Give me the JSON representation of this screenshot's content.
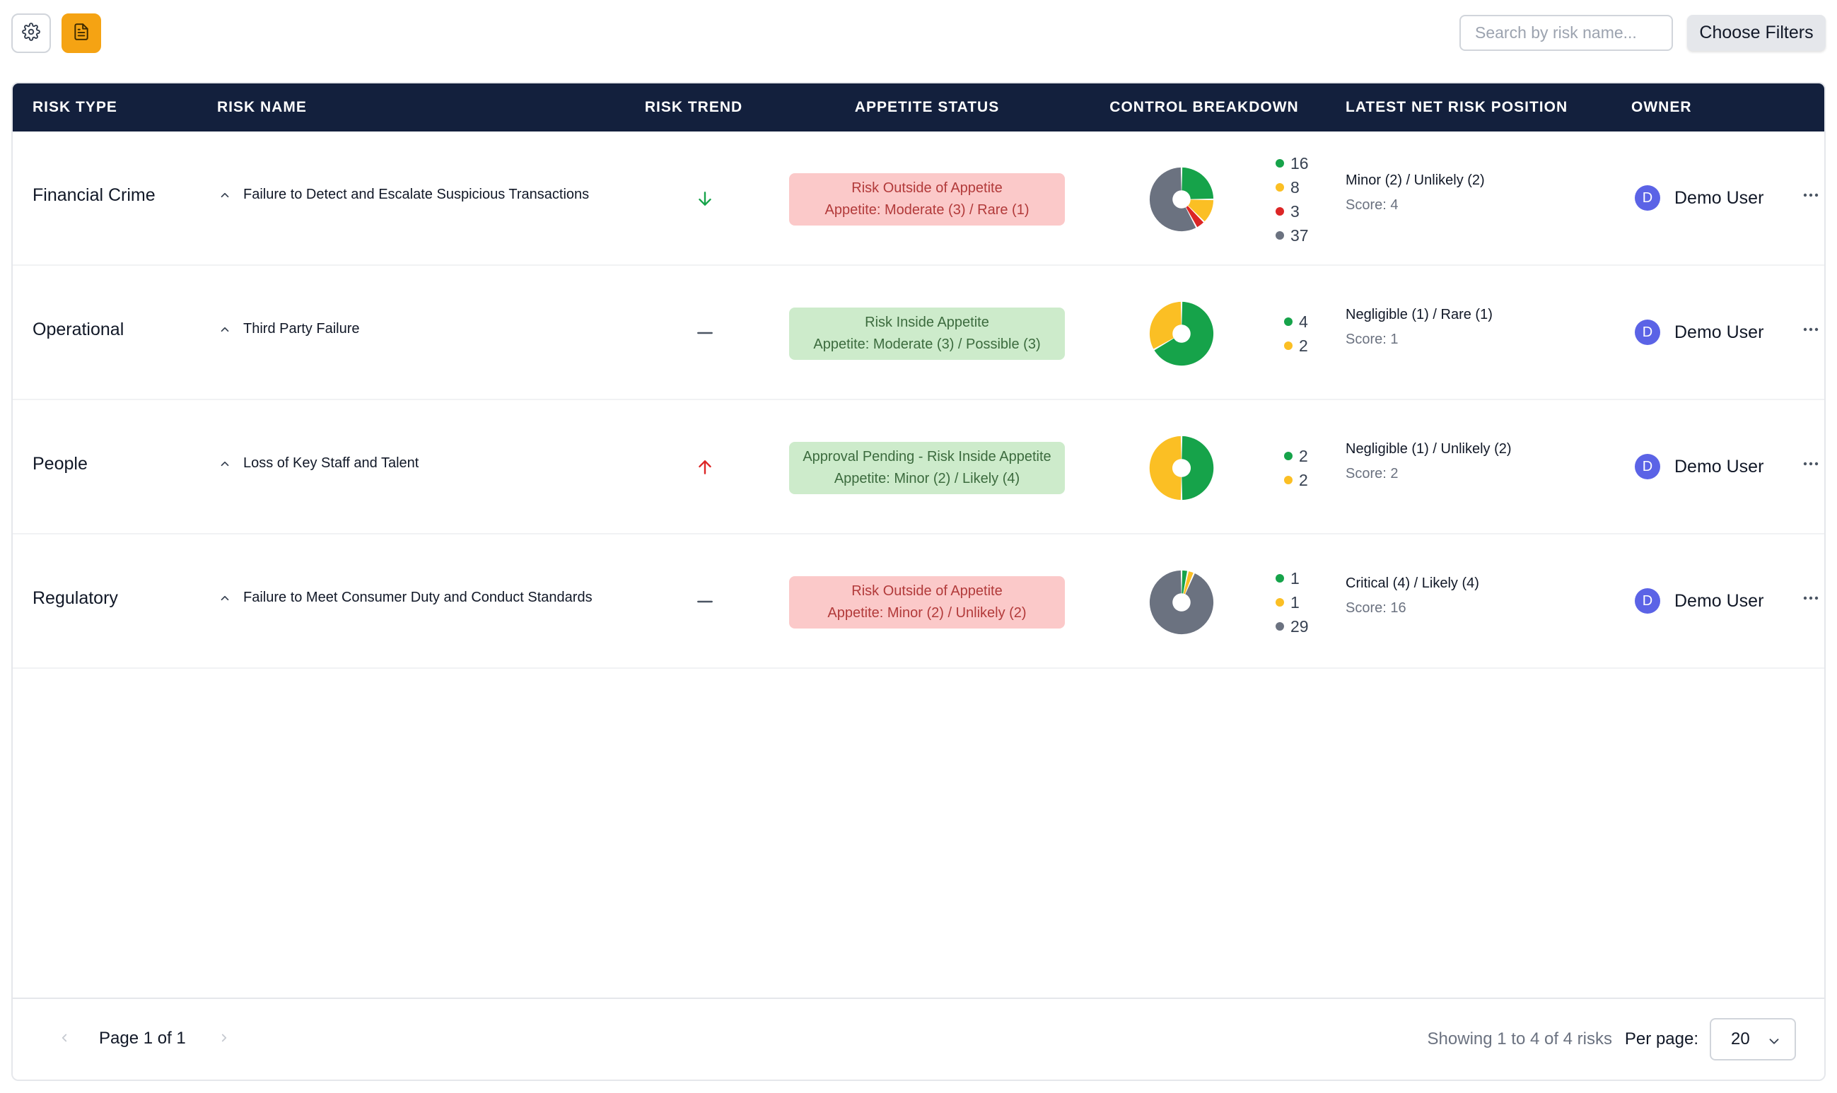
{
  "toolbar": {
    "settings_icon": "gear-icon",
    "report_icon": "document-icon",
    "search_placeholder": "Search by risk name...",
    "filters_label": "Choose Filters"
  },
  "table": {
    "headers": {
      "risk_type": "RISK TYPE",
      "risk_name": "RISK NAME",
      "risk_trend": "RISK TREND",
      "appetite_status": "APPETITE STATUS",
      "control_breakdown": "CONTROL BREAKDOWN",
      "net_risk": "LATEST NET RISK POSITION",
      "owner": "OWNER"
    },
    "rows": [
      {
        "type": "Financial Crime",
        "name": "Failure to Detect and Escalate Suspicious Transactions",
        "trend": "down",
        "appetite_status": "Risk Outside of Appetite",
        "appetite_detail": "Appetite: Moderate (3) / Rare (1)",
        "appetite_state": "outside",
        "controls": [
          {
            "color": "#16a34a",
            "count": "16"
          },
          {
            "color": "#fbbf24",
            "count": "8"
          },
          {
            "color": "#dc2626",
            "count": "3"
          },
          {
            "color": "#6b7280",
            "count": "37"
          }
        ],
        "net_position": "Minor (2) / Unlikely (2)",
        "score": "Score: 4",
        "owner_initial": "D",
        "owner": "Demo User"
      },
      {
        "type": "Operational",
        "name": "Third Party Failure",
        "trend": "flat",
        "appetite_status": "Risk Inside Appetite",
        "appetite_detail": "Appetite: Moderate (3) / Possible (3)",
        "appetite_state": "inside",
        "controls": [
          {
            "color": "#16a34a",
            "count": "4"
          },
          {
            "color": "#fbbf24",
            "count": "2"
          }
        ],
        "net_position": "Negligible (1) / Rare (1)",
        "score": "Score: 1",
        "owner_initial": "D",
        "owner": "Demo User"
      },
      {
        "type": "People",
        "name": "Loss of Key Staff and Talent",
        "trend": "up",
        "appetite_status": "Approval Pending - Risk Inside Appetite",
        "appetite_detail": "Appetite: Minor (2) / Likely (4)",
        "appetite_state": "inside",
        "controls": [
          {
            "color": "#16a34a",
            "count": "2"
          },
          {
            "color": "#fbbf24",
            "count": "2"
          }
        ],
        "net_position": "Negligible (1) / Unlikely (2)",
        "score": "Score: 2",
        "owner_initial": "D",
        "owner": "Demo User"
      },
      {
        "type": "Regulatory",
        "name": "Failure to Meet Consumer Duty and Conduct Standards",
        "trend": "flat",
        "appetite_status": "Risk Outside of Appetite",
        "appetite_detail": "Appetite: Minor (2) / Unlikely (2)",
        "appetite_state": "outside",
        "controls": [
          {
            "color": "#16a34a",
            "count": "1"
          },
          {
            "color": "#fbbf24",
            "count": "1"
          },
          {
            "color": "#6b7280",
            "count": "29"
          }
        ],
        "net_position": "Critical (4) / Likely (4)",
        "score": "Score: 16",
        "owner_initial": "D",
        "owner": "Demo User"
      }
    ]
  },
  "footer": {
    "page_text": "Page 1 of 1",
    "showing": "Showing 1 to 4 of 4 risks",
    "per_page_label": "Per page:",
    "per_page_value": "20"
  },
  "colors": {
    "header_bg": "#13203d",
    "accent": "#f5a313",
    "trend_down": "#16a34a",
    "trend_up": "#dc2626",
    "avatar": "#5b63e6"
  }
}
